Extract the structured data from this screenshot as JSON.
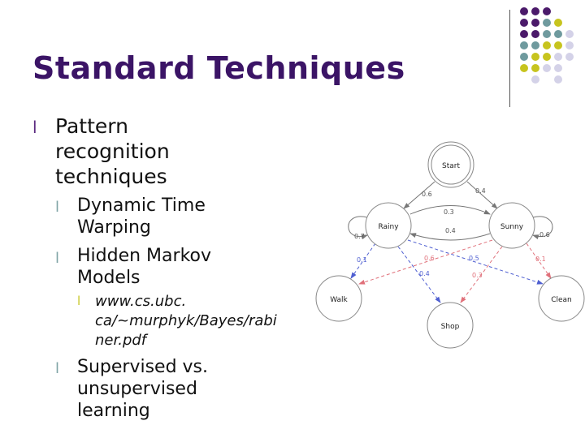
{
  "slide": {
    "title": "Standard Techniques",
    "marker": "l",
    "bullets": [
      {
        "level": 1,
        "text": "Pattern\nrecognition\ntechniques"
      },
      {
        "level": 2,
        "text": "Dynamic Time\nWarping"
      },
      {
        "level": 2,
        "text": "Hidden Markov\nModels"
      },
      {
        "level": 3,
        "text": "www.cs.ubc.\nca/~murphyk/Bayes/rabi\nner.pdf"
      },
      {
        "level": 2,
        "text": "Supervised vs.\nunsupervised\nlearning"
      }
    ]
  },
  "colors": {
    "title": "#3b1466",
    "marker_l1": "#5b2a80",
    "marker_l2": "#7fa3a6",
    "marker_l3": "#c8c82a",
    "purple": "#4b1a6a",
    "teal": "#6f9a9e",
    "olive": "#c7c41e",
    "lavender": "#d4d2e8",
    "blue_edge": "#4f5fd1",
    "red_edge": "#e0707a"
  },
  "diagram": {
    "nodes": {
      "start": "Start",
      "rainy": "Rainy",
      "sunny": "Sunny",
      "walk": "Walk",
      "shop": "Shop",
      "clean": "Clean"
    },
    "edge_labels": {
      "start_rainy": "0.6",
      "start_sunny": "0.4",
      "rainy_sunny": "0.3",
      "sunny_rainy": "0.4",
      "rainy_self": "0.7",
      "sunny_self": "0.6",
      "rainy_walk": "0.1",
      "rainy_shop": "0.4",
      "rainy_clean": "0.5",
      "sunny_walk": "0.6",
      "sunny_shop": "0.3",
      "sunny_clean": "0.1"
    }
  }
}
